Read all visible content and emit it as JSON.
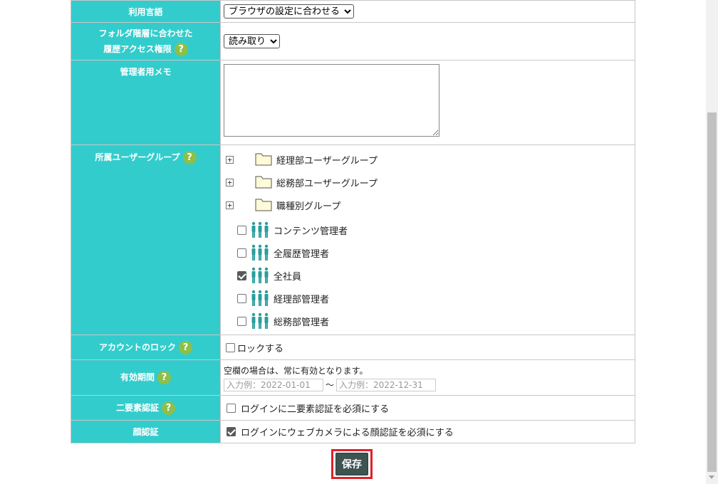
{
  "rows": {
    "language": {
      "label": "利用言語",
      "selected": "ブラウザの設定に合わせる"
    },
    "history_access": {
      "label_line1": "フォルダ階層に合わせた",
      "label_line2": "履歴アクセス権限",
      "selected": "読み取り"
    },
    "admin_memo": {
      "label": "管理者用メモ",
      "value": ""
    },
    "user_groups": {
      "label": "所属ユーザーグループ",
      "folders": [
        {
          "label": "経理部ユーザーグループ"
        },
        {
          "label": "総務部ユーザーグループ"
        },
        {
          "label": "職種別グループ"
        }
      ],
      "groups": [
        {
          "label": "コンテンツ管理者",
          "checked": false
        },
        {
          "label": "全履歴管理者",
          "checked": false
        },
        {
          "label": "全社員",
          "checked": true
        },
        {
          "label": "経理部管理者",
          "checked": false
        },
        {
          "label": "総務部管理者",
          "checked": false
        }
      ]
    },
    "account_lock": {
      "label": "アカウントのロック",
      "checkbox_label": "ロックする",
      "checked": false
    },
    "validity": {
      "label": "有効期間",
      "note": "空欄の場合は、常に有効となります。",
      "from_placeholder": "入力例：2022-01-01",
      "separator": "～",
      "to_placeholder": "入力例：2022-12-31"
    },
    "two_factor": {
      "label": "二要素認証",
      "checkbox_label": "ログインに二要素認証を必須にする",
      "checked": false
    },
    "face_auth": {
      "label": "顔認証",
      "checkbox_label": "ログインにウェブカメラによる顔認証を必須にする",
      "checked": true
    }
  },
  "help_glyph": "?",
  "expander_glyph": "+",
  "save_label": "保存",
  "colors": {
    "label_bg": "#33cccc",
    "help_bg": "#8dbf4a",
    "save_bg": "#3e5453",
    "highlight": "#e0202a"
  }
}
